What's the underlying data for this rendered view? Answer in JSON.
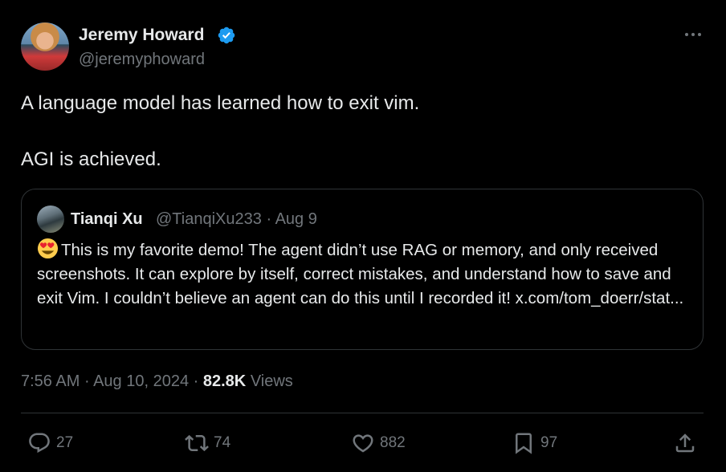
{
  "tweet": {
    "author": {
      "name": "Jeremy Howard",
      "handle": "@jeremyphoward",
      "verified_color": "#1d9bf0"
    },
    "lines": [
      "A language model has learned how to exit vim.",
      "AGI is achieved."
    ],
    "quoted": {
      "name": "Tianqi Xu",
      "handle": "@TianqiXu233",
      "separator": "·",
      "date": "Aug 9",
      "emoji": "heart-eyes-emoji",
      "text": "This is my favorite demo! The agent didn’t use RAG or memory, and only received screenshots. It can explore by itself, correct mistakes, and understand how to save and exit Vim. I couldn’t believe an agent can do this until I recorded it! x.com/tom_doerr/stat..."
    },
    "meta": {
      "time": "7:56 AM",
      "date": "Aug 10, 2024",
      "separator": "·",
      "views_count": "82.8K",
      "views_label": "Views"
    },
    "actions": {
      "replies": "27",
      "retweets": "74",
      "likes": "882",
      "bookmarks": "97"
    }
  },
  "colors": {
    "background": "#000000",
    "text": "#e7e9ea",
    "secondary": "#71767b",
    "border": "#2f3336",
    "accent": "#1d9bf0"
  }
}
